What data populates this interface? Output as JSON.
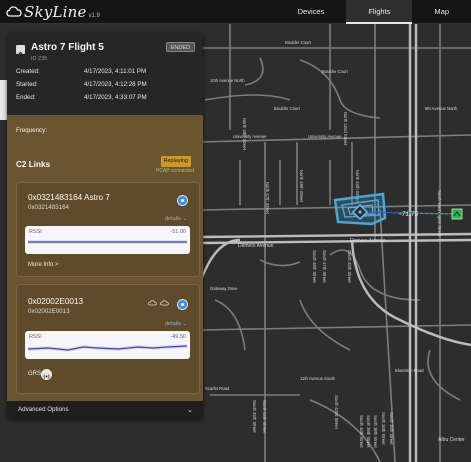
{
  "app": {
    "name": "SkyLine",
    "version": "v1.9"
  },
  "nav": {
    "tabs": [
      "Devices",
      "Flights",
      "Map"
    ],
    "active": "Flights"
  },
  "flight": {
    "title": "Astro 7 Flight 5",
    "id": "ID 235",
    "status": "ENDED",
    "times": [
      {
        "label": "Created:",
        "value": "4/17/2023, 4:11:01 PM"
      },
      {
        "label": "Started:",
        "value": "4/17/2023, 4:12:28 PM"
      },
      {
        "label": "Ended:",
        "value": "4/17/2023, 4:33:07 PM"
      }
    ],
    "frequency_label": "Frequency:"
  },
  "c2": {
    "heading": "C2 Links",
    "replay_badge": "Replaying",
    "pcap_note": "PCAP connected",
    "links": [
      {
        "title": "0x0321483164 Astro 7",
        "subtitle": "0x0321483164",
        "details": "details",
        "rssi_label": "RSSI",
        "rssi_value": "-51.00",
        "footer": "More Info >"
      },
      {
        "title": "0x02002E0013",
        "subtitle": "0x02002E0013",
        "details": "details",
        "rssi_label": "RSSI",
        "rssi_value": "-49.50",
        "footer": "GRS:"
      }
    ]
  },
  "advanced": "Advanced Options",
  "map": {
    "streets": {
      "boulder_ct": "Boulder Court",
      "university": "University Avenue",
      "demers": "Demers Avenue",
      "s48": "South 48th Street",
      "s47": "South 47th Street",
      "s46": "South 46th Street",
      "s45": "South 45th Street",
      "s44": "South 44th Street",
      "s42": "South 42nd Street",
      "s40": "South 40th Street",
      "s39": "South 39th Street",
      "s38": "South 38th Street",
      "s36": "South 36th Street",
      "s35": "South 35th Street",
      "sw": "South Washington Street",
      "n42": "North 42nd Street",
      "n48": "North 48th Street",
      "n47": "North 47th Street",
      "n45": "North 45th Street",
      "n44": "North 44th Street",
      "tenth_ave": "10th Avenue North",
      "scarlet": "Scarlet Road",
      "gateway": "Gateway Drive",
      "eleventh": "11th Avenue South",
      "bluestem": "Bluestem Road",
      "sixth": "6th Avenue North",
      "altru": "Altru Center"
    },
    "distance_label": "~71.75"
  },
  "colors": {
    "panel": "#6b5530",
    "accent": "#3f90d8",
    "replay": "#c99830",
    "drone_path": "#4aa8d8",
    "home": "#2fb24a"
  }
}
